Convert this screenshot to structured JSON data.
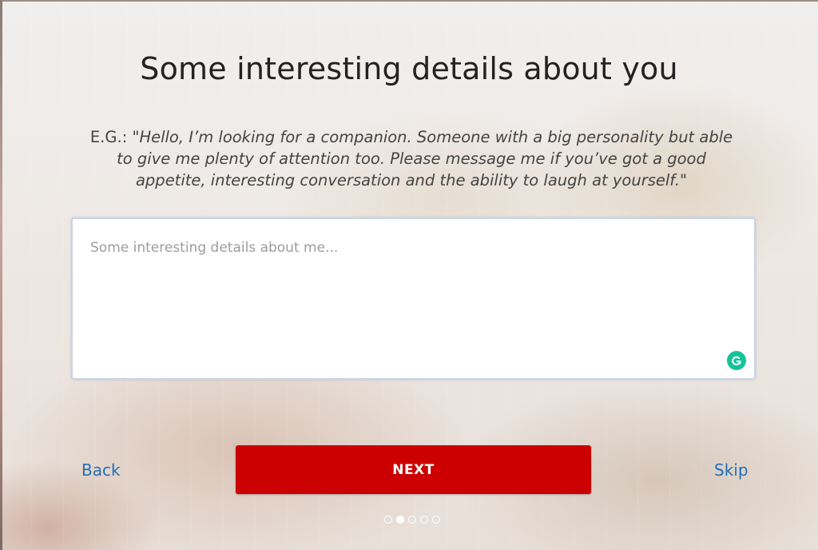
{
  "page": {
    "title": "Some interesting details about you",
    "example_prefix": "E.G.: ",
    "example_quote": "\"Hello, I’m looking for a companion. Someone with a big personality but able to give me plenty of attention too. Please message me if you’ve got a good appetite, interesting conversation and the ability to laugh at yourself.\""
  },
  "form": {
    "details_value": "",
    "details_placeholder": "Some interesting details about me..."
  },
  "nav": {
    "back_label": "Back",
    "next_label": "NEXT",
    "skip_label": "Skip"
  },
  "progress": {
    "total_steps": 5,
    "current_step": 2
  },
  "colors": {
    "accent": "#cc0000",
    "link": "#1f6fb8",
    "grammarly": "#15c39a"
  },
  "icons": {
    "grammarly": "grammarly-icon"
  }
}
